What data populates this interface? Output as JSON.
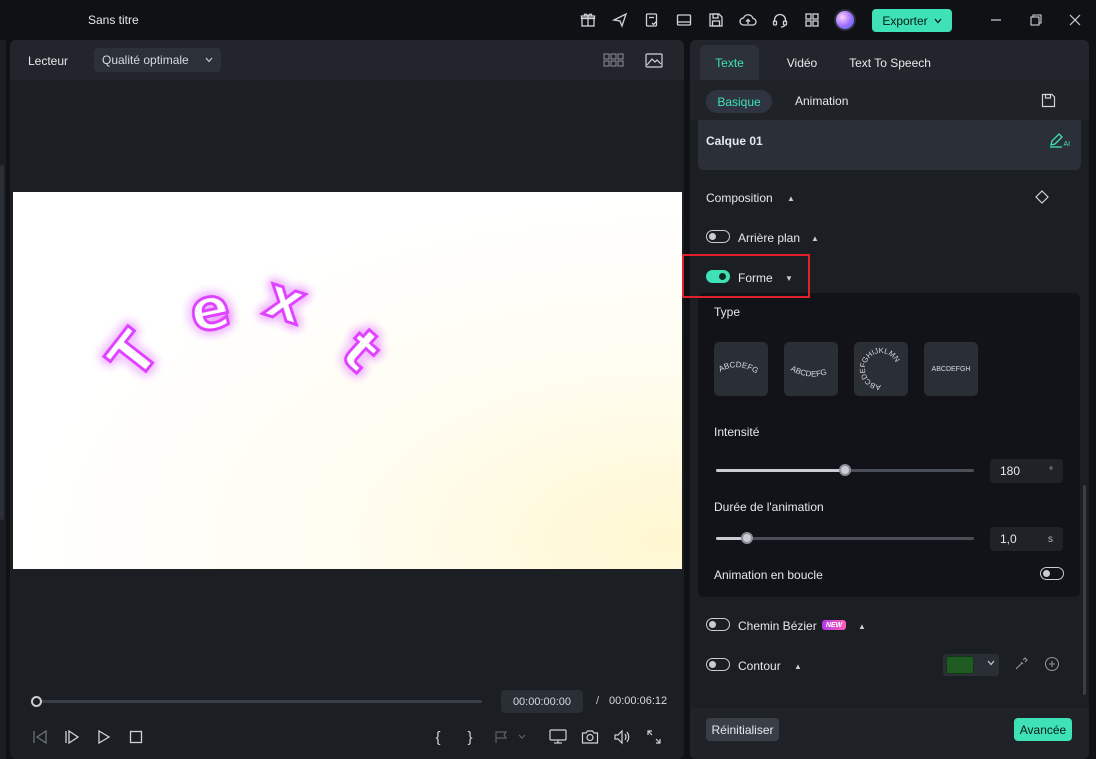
{
  "titlebar": {
    "title": "Sans titre",
    "export_label": "Exporter",
    "icons": [
      "gift-icon",
      "send-icon",
      "clipboard-check-icon",
      "layout-icon",
      "save-icon",
      "cloud-upload-icon",
      "headset-icon",
      "grid-icon",
      "avatar-icon"
    ]
  },
  "player": {
    "label": "Lecteur",
    "quality": "Qualité optimale",
    "current_time": "00:00:00:00",
    "separator": "/",
    "total_time": "00:00:06:12",
    "progress_fraction": 0.0,
    "preview_text": "Text"
  },
  "panel": {
    "tabs": [
      "Texte",
      "Vidéo",
      "Text To Speech"
    ],
    "active_tab": "Texte",
    "subtabs": [
      "Basique",
      "Animation"
    ],
    "active_subtab": "Basique",
    "layer_name": "Calque 01",
    "composition_label": "Composition",
    "background_label": "Arrière plan",
    "background_on": false,
    "shape_label": "Forme",
    "shape_on": true,
    "type_label": "Type",
    "type_tile_text": [
      "ABCDEFG",
      "ABCDEFG",
      "ABCDEFGHIJKLMN",
      "ABCDEFGH"
    ],
    "intensity_label": "Intensité",
    "intensity_value": "180",
    "intensity_unit": "°",
    "intensity_fraction": 0.5,
    "duration_label": "Durée de l'animation",
    "duration_value": "1,0",
    "duration_unit": "s",
    "duration_fraction": 0.12,
    "loop_label": "Animation en boucle",
    "loop_on": false,
    "bezier_label": "Chemin Bézier",
    "bezier_badge": "NEW",
    "bezier_on": false,
    "outline_label": "Contour",
    "outline_on": false,
    "outline_color": "#1f5a23",
    "reset_label": "Réinitialiser",
    "advanced_label": "Avancée"
  },
  "colors": {
    "accent": "#3ee2b6",
    "highlight": "#e0202a",
    "glow": "#e040ff"
  }
}
